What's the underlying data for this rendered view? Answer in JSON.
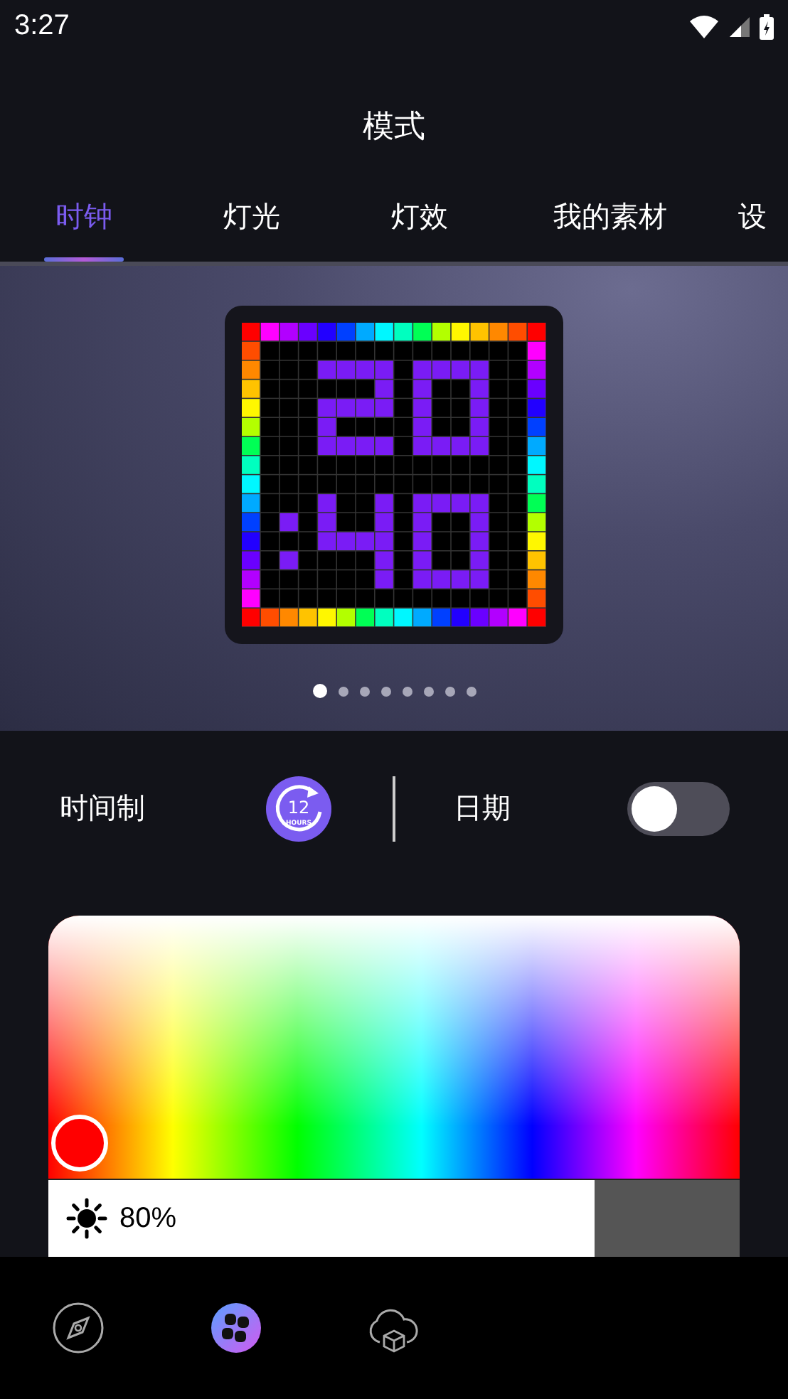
{
  "status_bar": {
    "time": "3:27"
  },
  "header": {
    "title": "模式"
  },
  "tabs": [
    {
      "label": "时钟",
      "selected": true
    },
    {
      "label": "灯光",
      "selected": false
    },
    {
      "label": "灯效",
      "selected": false
    },
    {
      "label": "我的素材",
      "selected": false
    },
    {
      "label": "设",
      "selected": false
    }
  ],
  "preview": {
    "pages": [
      {
        "selected": true
      },
      {
        "selected": false
      },
      {
        "selected": false
      },
      {
        "selected": false
      },
      {
        "selected": false
      },
      {
        "selected": false
      },
      {
        "selected": false
      },
      {
        "selected": false
      }
    ]
  },
  "settings": {
    "time_format": {
      "label": "时间制",
      "icon_number": "12",
      "icon_caption": "HOURS"
    },
    "date": {
      "label": "日期",
      "on": false
    }
  },
  "color_picker": {
    "color": "#ff0000",
    "brightness": {
      "level": 0.79,
      "reading": "80%"
    }
  },
  "bottom_nav": [
    {
      "kind": "compass",
      "selected": false
    },
    {
      "kind": "modes",
      "selected": true
    },
    {
      "kind": "cloud",
      "selected": false
    }
  ]
}
